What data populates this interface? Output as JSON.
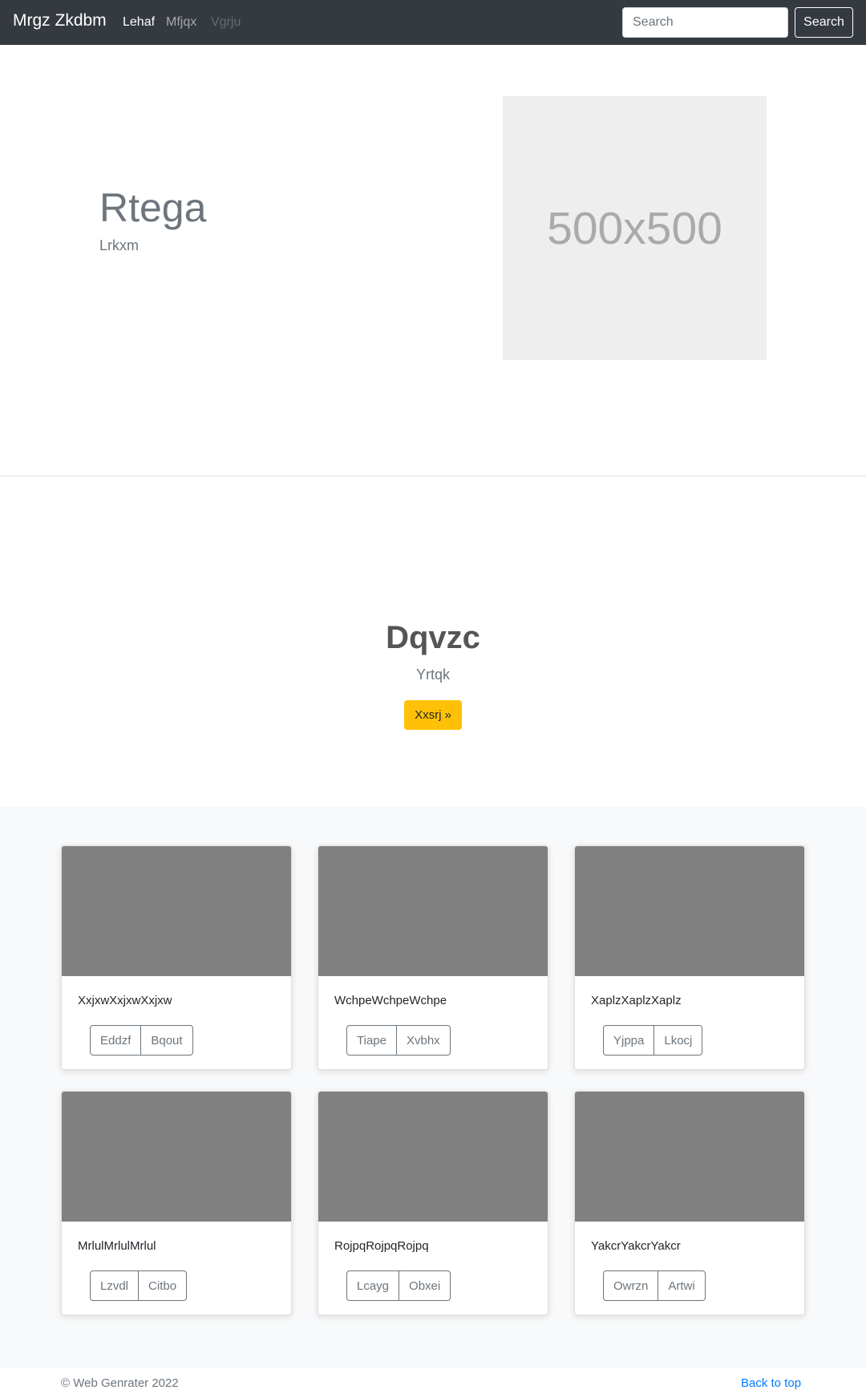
{
  "navbar": {
    "brand": "Mrgz Zkdbm",
    "links": [
      "Lehaf",
      "Mfjqx",
      "Vgrju"
    ],
    "search_placeholder": "Search",
    "search_button": "Search"
  },
  "hero": {
    "title": "Rtega",
    "subtitle": "Lrkxm",
    "placeholder_text": "500x500"
  },
  "cta": {
    "title": "Dqvzc",
    "subtitle": "Yrtqk",
    "button": "Xxsrj »"
  },
  "cards": [
    {
      "text": "XxjxwXxjxwXxjxw",
      "buttons": [
        "Eddzf",
        "Bqout"
      ]
    },
    {
      "text": "WchpeWchpeWchpe",
      "buttons": [
        "Tiape",
        "Xvbhx"
      ]
    },
    {
      "text": "XaplzXaplzXaplz",
      "buttons": [
        "Yjppa",
        "Lkocj"
      ]
    },
    {
      "text": "MrlulMrlulMrlul",
      "buttons": [
        "Lzvdl",
        "Citbo"
      ]
    },
    {
      "text": "RojpqRojpqRojpq",
      "buttons": [
        "Lcayg",
        "Obxei"
      ]
    },
    {
      "text": "YakcrYakcrYakcr",
      "buttons": [
        "Owrzn",
        "Artwi"
      ]
    }
  ],
  "footer": {
    "copyright": "© Web Genrater 2022",
    "back_to_top": "Back to top"
  },
  "colors": {
    "navbar_bg": "#343a40",
    "accent_warning": "#ffc107",
    "link": "#007bff",
    "card_image": "#808080"
  }
}
